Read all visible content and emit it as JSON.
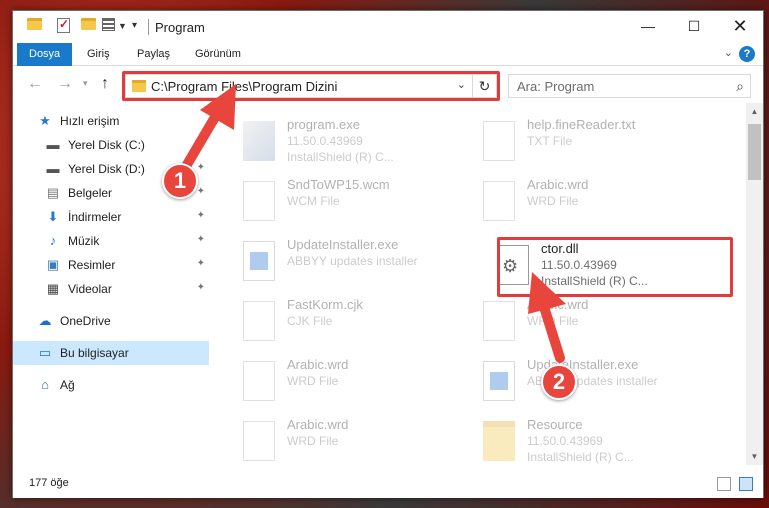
{
  "window": {
    "title": "Program"
  },
  "ribbon": {
    "tabs": [
      "Dosya",
      "Giriş",
      "Paylaş",
      "Görünüm"
    ],
    "help": "?"
  },
  "address": {
    "path": "C:\\Program Files\\Program Dizini"
  },
  "search": {
    "placeholder": "Ara: Program"
  },
  "sidebar": {
    "items": [
      {
        "label": "Hızlı erişim",
        "icon": "star-icon"
      },
      {
        "label": "Yerel Disk (C:)",
        "icon": "drive-icon"
      },
      {
        "label": "Yerel Disk (D:)",
        "icon": "drive-icon"
      },
      {
        "label": "Belgeler",
        "icon": "documents-icon"
      },
      {
        "label": "İndirmeler",
        "icon": "download-icon"
      },
      {
        "label": "Müzik",
        "icon": "music-icon"
      },
      {
        "label": "Resimler",
        "icon": "pictures-icon"
      },
      {
        "label": "Videolar",
        "icon": "videos-icon"
      },
      {
        "label": "OneDrive",
        "icon": "cloud-icon"
      },
      {
        "label": "Bu bilgisayar",
        "icon": "computer-icon"
      },
      {
        "label": "Ağ",
        "icon": "network-icon"
      }
    ]
  },
  "files": [
    {
      "name": "program.exe",
      "l1": "11.50.0.43969",
      "l2": "InstallShield (R) C...",
      "icon": "exe"
    },
    {
      "name": "help.fineReader.txt",
      "l1": "TXT File",
      "l2": "",
      "icon": "doc"
    },
    {
      "name": "SndToWP15.wcm",
      "l1": "WCM File",
      "l2": "",
      "icon": "doc"
    },
    {
      "name": "Arabic.wrd",
      "l1": "WRD File",
      "l2": "",
      "icon": "doc"
    },
    {
      "name": "UpdateInstaller.exe",
      "l1": "ABBYY updates installer",
      "l2": "",
      "icon": "installer"
    },
    {
      "name": "ctor.dll",
      "l1": "11.50.0.43969",
      "l2": "InstallShield (R) C...",
      "icon": "gear"
    },
    {
      "name": "FastKorm.cjk",
      "l1": "CJK File",
      "l2": "",
      "icon": "doc"
    },
    {
      "name": "Arabic.wrd",
      "l1": "WRD File",
      "l2": "",
      "icon": "doc"
    },
    {
      "name": "Arabic.wrd",
      "l1": "WRD File",
      "l2": "",
      "icon": "doc"
    },
    {
      "name": "UpdateInstaller.exe",
      "l1": "ABBYY updates installer",
      "l2": "",
      "icon": "installer"
    },
    {
      "name": "Arabic.wrd",
      "l1": "WRD File",
      "l2": "",
      "icon": "doc"
    },
    {
      "name": "Resource",
      "l1": "11.50.0.43969",
      "l2": "InstallShield (R) C...",
      "icon": "folder"
    }
  ],
  "status": {
    "count": "177 öğe"
  },
  "annotations": {
    "badge1": "1",
    "badge2": "2",
    "color": "#e8453c"
  }
}
